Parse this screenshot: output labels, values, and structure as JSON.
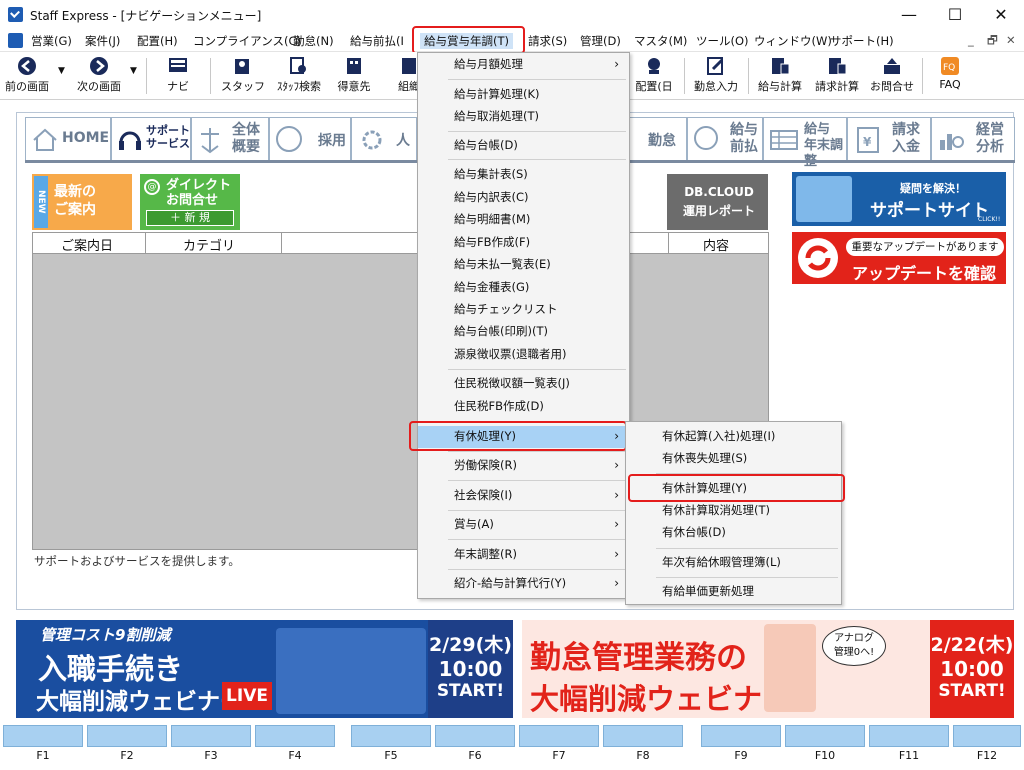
{
  "window": {
    "title": "Staff Express - [ナビゲーションメニュー]",
    "minimize": "—",
    "maximize": "☐",
    "close": "✕"
  },
  "menubar": {
    "items": [
      "営業(G)",
      "案件(J)",
      "配置(H)",
      "コンプライアンス(C)",
      "勤怠(N)",
      "給与前払(I",
      "給与賞与年調(T)",
      "請求(S)",
      "管理(D)",
      "マスタ(M)",
      "ツール(O)",
      "ウィンドウ(W)",
      "サポート(H)"
    ],
    "mdi": [
      "_",
      "🗗",
      "✕"
    ]
  },
  "toolbar": {
    "items": [
      "前の画面",
      "次の画面",
      "ナビ",
      "スタッフ",
      "ｽﾀｯﾌ検索",
      "得意先",
      "組織",
      "配置(日",
      "勤怠入力",
      "給与計算",
      "請求計算",
      "お問合せ",
      "FAQ"
    ]
  },
  "tabs": {
    "items": [
      "HOME",
      "サポート\nサービス",
      "全体\n概要",
      "採用",
      "人",
      "勤怠",
      "給与\n前払",
      "給与\n年末調整",
      "請求\n入金",
      "経営\n分析"
    ]
  },
  "panel": {
    "new_button": "最新の\nご案内",
    "new_tag": "NEW",
    "direct_button": "ダイレクト\nお問合せ",
    "direct_sub": "＋ 新 規",
    "db_button": "DB.CLOUD\n運用レポート",
    "columns": [
      "ご案内日",
      "カテゴリ",
      "内容"
    ],
    "status": "サポートおよびサービスを提供します。"
  },
  "banners": {
    "support_small": "疑問を解決！",
    "support_big": "サポートサイト",
    "support_click": "CLICK!!",
    "update_small": "重要なアップデートがあります",
    "update_big": "アップデートを確認"
  },
  "ads": {
    "ad1_top": "管理コスト9割削減",
    "ad1_main": "入職手続き",
    "ad1_sub": "大幅削減ウェビナー",
    "ad1_live": "LIVE",
    "ad1_date": "2/29(木)",
    "ad1_time": "10:00",
    "ad1_start": "START!",
    "ad2_main": "勤怠管理業務の",
    "ad2_sub": "大幅削減ウェビナー",
    "ad2_bubble": "アナログ\n管理0へ!",
    "ad2_date": "2/22(木)",
    "ad2_time": "10:00",
    "ad2_start": "START!"
  },
  "dropdown": {
    "items": [
      {
        "label": "給与月額処理",
        "arrow": "›"
      },
      {
        "label": "給与計算処理(K)"
      },
      {
        "label": "給与取消処理(T)"
      },
      {
        "label": "給与台帳(D)"
      },
      {
        "label": "給与集計表(S)"
      },
      {
        "label": "給与内訳表(C)"
      },
      {
        "label": "給与明細書(M)"
      },
      {
        "label": "給与FB作成(F)"
      },
      {
        "label": "給与未払一覧表(E)"
      },
      {
        "label": "給与金種表(G)"
      },
      {
        "label": "給与チェックリスト"
      },
      {
        "label": "給与台帳(印刷)(T)"
      },
      {
        "label": "源泉徴収票(退職者用)"
      },
      {
        "label": "住民税徴収額一覧表(J)"
      },
      {
        "label": "住民税FB作成(D)"
      },
      {
        "label": "有休処理(Y)",
        "arrow": "›"
      },
      {
        "label": "労働保険(R)",
        "arrow": "›"
      },
      {
        "label": "社会保険(I)",
        "arrow": "›"
      },
      {
        "label": "賞与(A)",
        "arrow": "›"
      },
      {
        "label": "年末調整(R)",
        "arrow": "›"
      },
      {
        "label": "紹介-給与計算代行(Y)",
        "arrow": "›"
      }
    ]
  },
  "submenu": {
    "items": [
      "有休起算(入社)処理(I)",
      "有休喪失処理(S)",
      "有休計算処理(Y)",
      "有休計算取消処理(T)",
      "有休台帳(D)",
      "年次有給休暇管理簿(L)",
      "有給単価更新処理"
    ]
  },
  "fkeys": [
    "F1",
    "F2",
    "F3",
    "F4",
    "F5",
    "F6",
    "F7",
    "F8",
    "F9",
    "F10",
    "F11",
    "F12"
  ]
}
